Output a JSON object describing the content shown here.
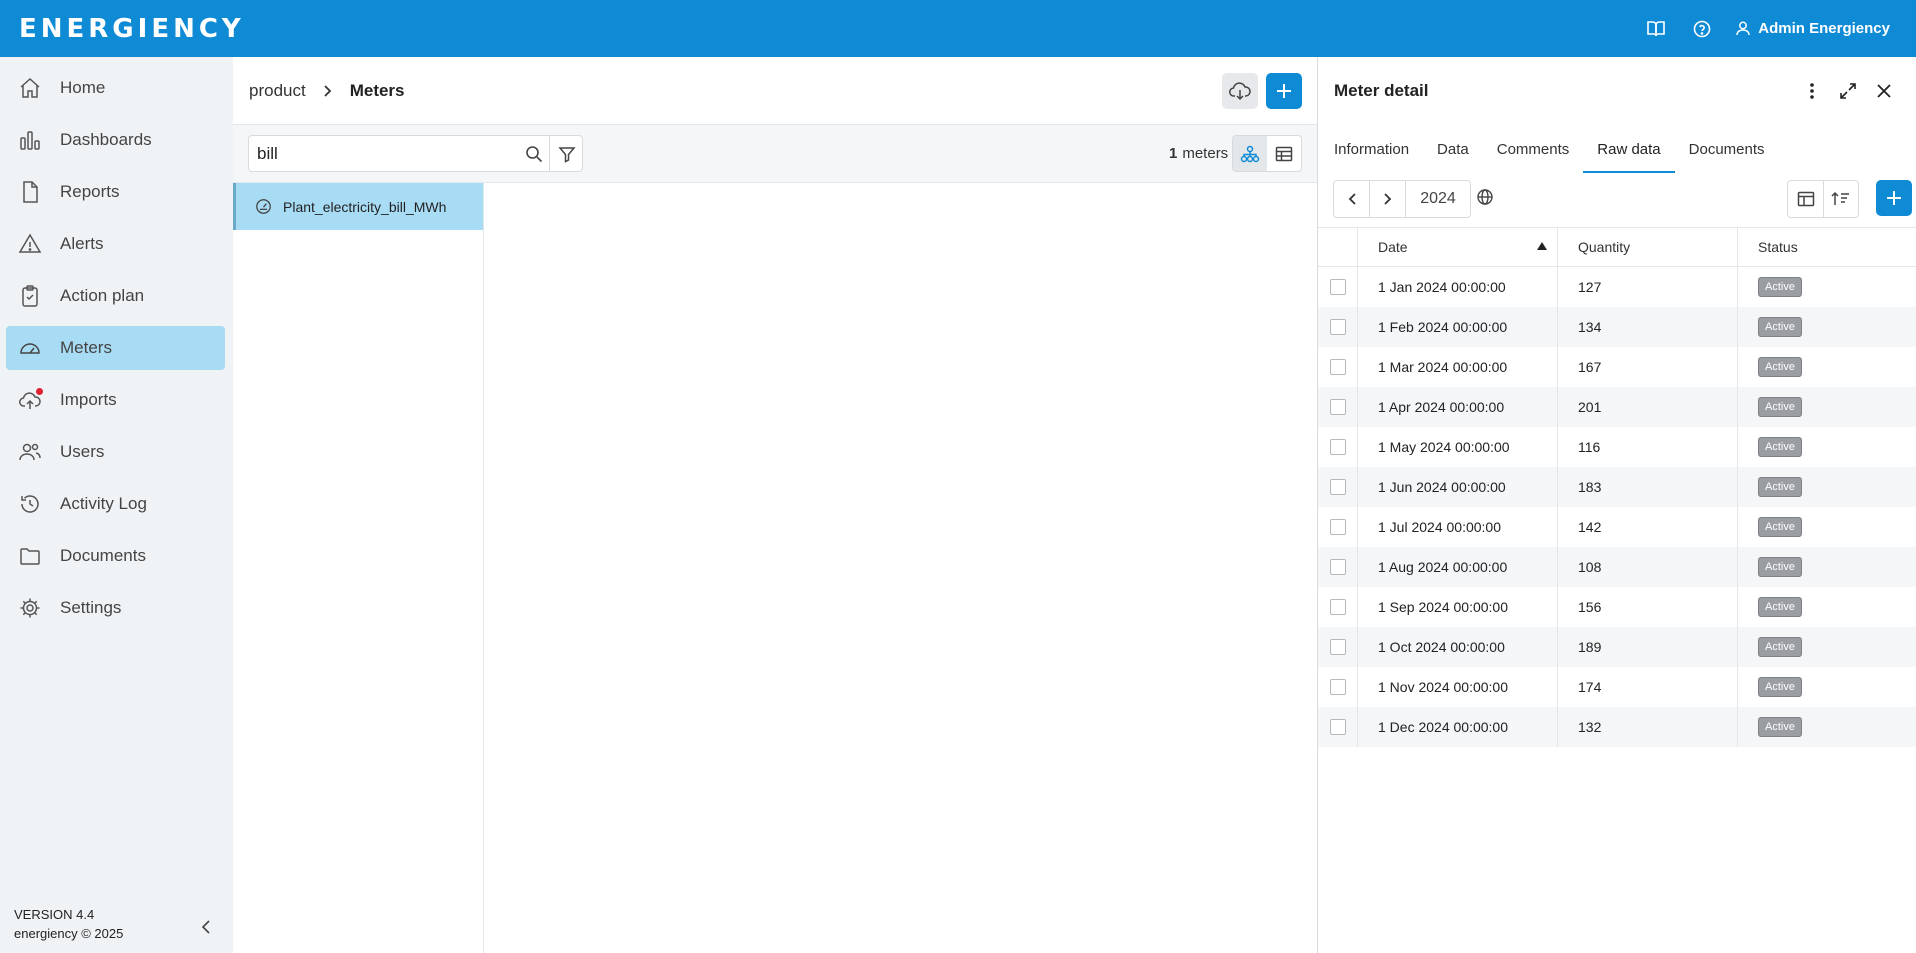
{
  "header": {
    "logo": "ENERGIENCY",
    "user_name": "Admin Energiency"
  },
  "sidebar": {
    "items": [
      {
        "label": "Home",
        "icon": "home-icon"
      },
      {
        "label": "Dashboards",
        "icon": "bar-chart-icon"
      },
      {
        "label": "Reports",
        "icon": "document-icon"
      },
      {
        "label": "Alerts",
        "icon": "warning-icon"
      },
      {
        "label": "Action plan",
        "icon": "clipboard-check-icon"
      },
      {
        "label": "Meters",
        "icon": "gauge-icon"
      },
      {
        "label": "Imports",
        "icon": "cloud-upload-icon"
      },
      {
        "label": "Users",
        "icon": "users-icon"
      },
      {
        "label": "Activity Log",
        "icon": "history-icon"
      },
      {
        "label": "Documents",
        "icon": "folder-icon"
      },
      {
        "label": "Settings",
        "icon": "gear-icon"
      }
    ],
    "active_item": "Meters",
    "version": "VERSION 4.4",
    "copyright": "energiency © 2025"
  },
  "main": {
    "breadcrumb": {
      "parent": "product",
      "current": "Meters"
    },
    "search": {
      "value": "bill",
      "placeholder": ""
    },
    "meters_count": "1",
    "meters_count_label": "meters",
    "tree": {
      "items": [
        {
          "label": "Plant_electricity_bill_MWh"
        }
      ]
    }
  },
  "detail": {
    "title": "Meter detail",
    "tabs": [
      "Information",
      "Data",
      "Comments",
      "Raw data",
      "Documents"
    ],
    "active_tab": "Raw data",
    "year": "2024",
    "columns": {
      "date": "Date",
      "quantity": "Quantity",
      "status": "Status"
    },
    "rows": [
      {
        "date": "1 Jan 2024 00:00:00",
        "quantity": "127",
        "status": "Active"
      },
      {
        "date": "1 Feb 2024 00:00:00",
        "quantity": "134",
        "status": "Active"
      },
      {
        "date": "1 Mar 2024 00:00:00",
        "quantity": "167",
        "status": "Active"
      },
      {
        "date": "1 Apr 2024 00:00:00",
        "quantity": "201",
        "status": "Active"
      },
      {
        "date": "1 May 2024 00:00:00",
        "quantity": "116",
        "status": "Active"
      },
      {
        "date": "1 Jun 2024 00:00:00",
        "quantity": "183",
        "status": "Active"
      },
      {
        "date": "1 Jul 2024 00:00:00",
        "quantity": "142",
        "status": "Active"
      },
      {
        "date": "1 Aug 2024 00:00:00",
        "quantity": "108",
        "status": "Active"
      },
      {
        "date": "1 Sep 2024 00:00:00",
        "quantity": "156",
        "status": "Active"
      },
      {
        "date": "1 Oct 2024 00:00:00",
        "quantity": "189",
        "status": "Active"
      },
      {
        "date": "1 Nov 2024 00:00:00",
        "quantity": "174",
        "status": "Active"
      },
      {
        "date": "1 Dec 2024 00:00:00",
        "quantity": "132",
        "status": "Active"
      }
    ]
  },
  "colors": {
    "brand": "#0f8bd6",
    "active_nav": "#a8dcf4",
    "sidebar_bg": "#f0f3f6",
    "badge": "#9a9ea2",
    "notification_dot": "#e0202f"
  }
}
